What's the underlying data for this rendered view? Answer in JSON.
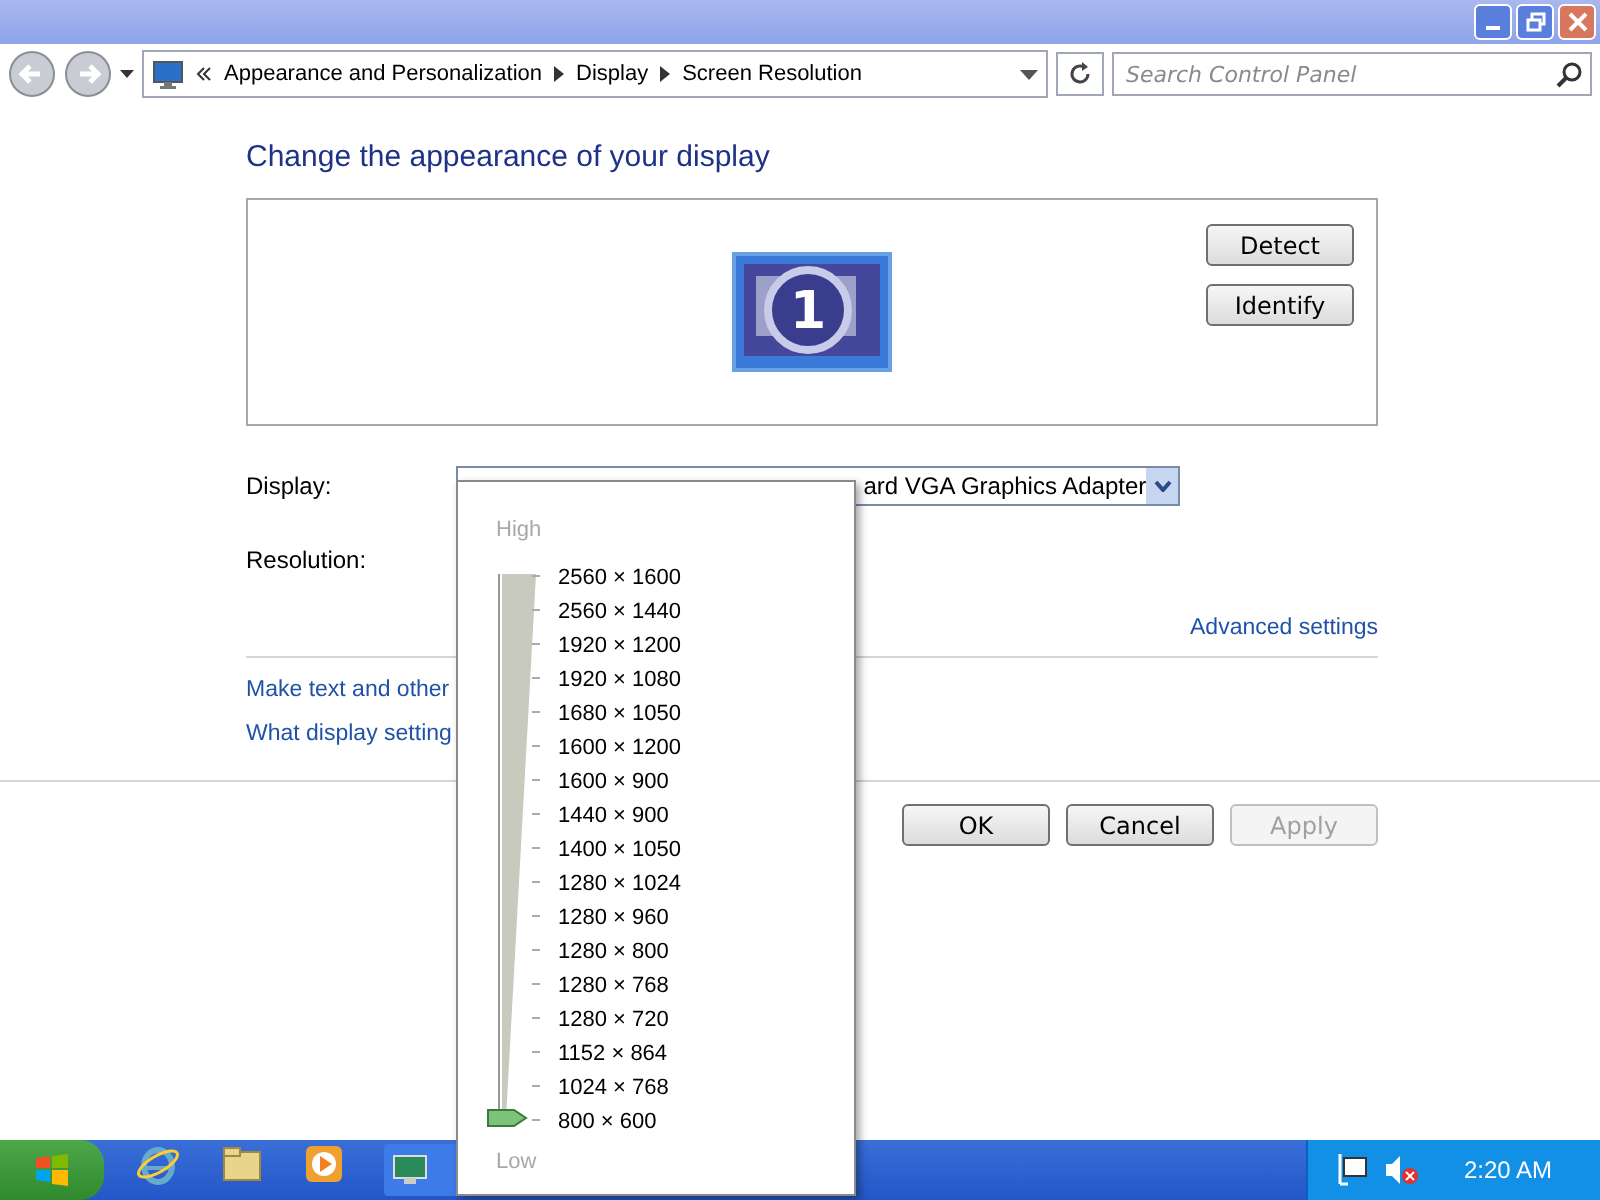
{
  "address_bar": {
    "breadcrumbs": [
      "Appearance and Personalization",
      "Display",
      "Screen Resolution"
    ]
  },
  "search": {
    "placeholder": "Search Control Panel"
  },
  "heading": "Change the appearance of your display",
  "monitor_buttons": [
    "Detect",
    "Identify"
  ],
  "monitor": {
    "number": "1"
  },
  "display_field": {
    "label": "Display:",
    "value": "ard VGA Graphics Adapter"
  },
  "resolution_field": {
    "label": "Resolution:"
  },
  "advanced_link": "Advanced settings",
  "links": [
    "Make text and other",
    "What display setting"
  ],
  "buttons": [
    {
      "label": "OK",
      "disabled": false
    },
    {
      "label": "Cancel",
      "disabled": false
    },
    {
      "label": "Apply",
      "disabled": true
    }
  ],
  "resolution_popup": {
    "high_label": "High",
    "low_label": "Low",
    "level": 0,
    "options": [
      "2560 × 1600",
      "2560 × 1440",
      "1920 × 1200",
      "1920 × 1080",
      "1680 × 1050",
      "1600 × 1200",
      "1600 × 900",
      "1440 × 900",
      "1400 × 1050",
      "1280 × 1024",
      "1280 × 960",
      "1280 × 800",
      "1280 × 768",
      "1280 × 720",
      "1152 × 864",
      "1024 × 768",
      "800 × 600"
    ]
  },
  "taskbar": {
    "clock": "2:20 AM"
  }
}
